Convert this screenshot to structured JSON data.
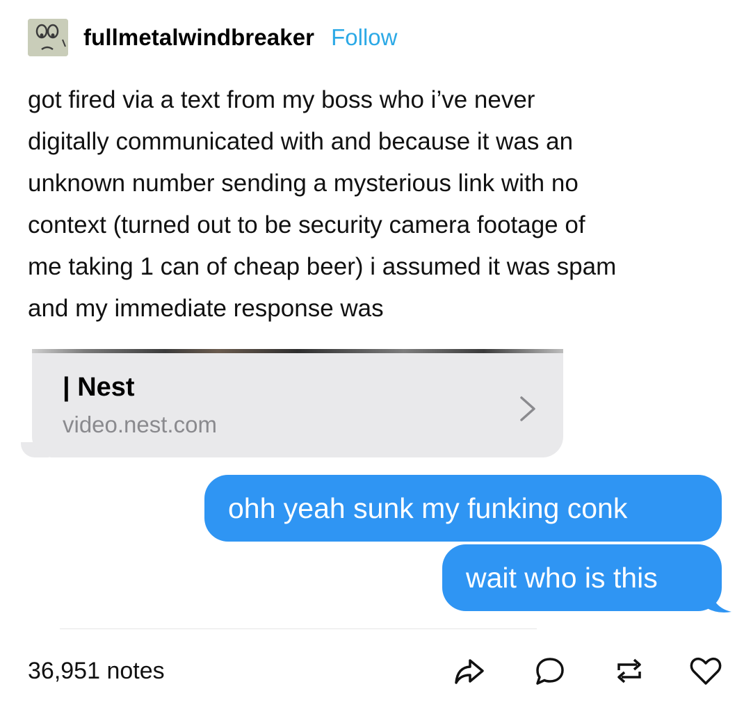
{
  "post": {
    "username": "fullmetalwindbreaker",
    "follow_label": "Follow",
    "body_lines": [
      "got fired via a text from my boss who i’ve never",
      "digitally communicated with and because it was an",
      "unknown number sending a mysterious link with no",
      "context (turned out to be security camera footage of",
      "me taking 1 can of cheap beer) i assumed it was spam",
      "and my immediate response was"
    ]
  },
  "conversation": {
    "link_preview": {
      "title": "| Nest",
      "url": "video.nest.com"
    },
    "sent_messages": [
      "ohh yeah sunk my funking conk",
      "wait who is this"
    ]
  },
  "footer": {
    "notes": "36,951 notes"
  },
  "colors": {
    "accent": "#2ca9e6",
    "bubble_blue": "#2f95f3",
    "bubble_gray": "#e9e9eb"
  },
  "icons": [
    "avatar",
    "chevron-right-icon",
    "share-icon",
    "reply-icon",
    "reblog-icon",
    "heart-icon"
  ]
}
